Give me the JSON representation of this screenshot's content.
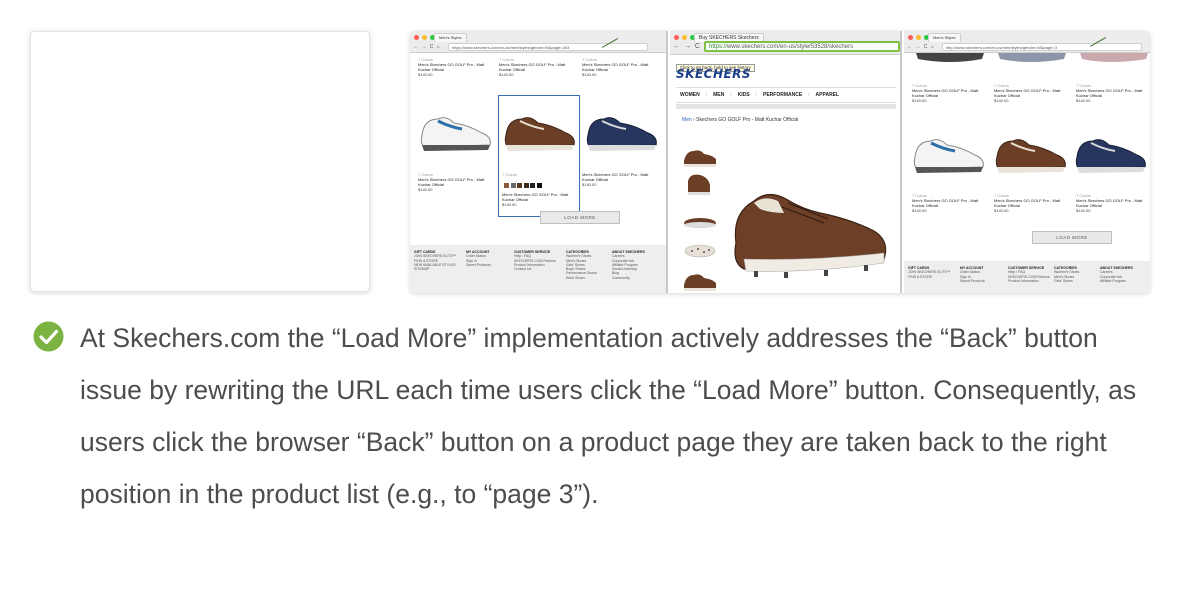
{
  "screenshot_left": {
    "tab_title": "Men's Styles",
    "url": "https://www.skechers.com/en-us/men/styles/gender=M&page=2#3",
    "products": [
      {
        "colors": "7 Colors",
        "name": "Men's Skechers GO GOLF Pro - Matt Kuchar Official",
        "price": "$140.00"
      },
      {
        "colors": "7 Colors",
        "name": "Men's Skechers GO GOLF Pro - Matt Kuchar Official",
        "price": "$140.00"
      },
      {
        "colors": "7 Colors",
        "name": "Men's Skechers GO GOLF Pro - Matt Kuchar Official",
        "price": "$140.00"
      },
      {
        "colors": "7 Colors",
        "name": "Men's Skechers GO GOLF Pro - Matt Kuchar Official",
        "price": "$140.00"
      },
      {
        "colors": "7 Colors",
        "name": "Men's Skechers GO GOLF Pro - Matt Kuchar Official",
        "price": "$140.00"
      },
      {
        "colors": "",
        "name": "Men's Skechers GO GOLF Pro - Matt Kuchar Official",
        "price": "$140.00"
      }
    ],
    "load_more_label": "LOAD MORE",
    "footer": [
      {
        "heading": "GIFT CARDS",
        "lines": [
          "JOIN SKECHERS ELITE™",
          "FIND A STORE",
          "NEW AVAILABLE STYLES",
          "SITEMAP"
        ]
      },
      {
        "heading": "MY ACCOUNT",
        "lines": [
          "Order Status",
          "Sign In",
          "Saved Products"
        ]
      },
      {
        "heading": "CUSTOMER SERVICE",
        "lines": [
          "Help / FAQ",
          "SKECHERS.COM Returns",
          "Product Information",
          "Contact Us"
        ]
      },
      {
        "heading": "CATEGORIES",
        "lines": [
          "Women's Shoes",
          "Men's Shoes",
          "Girls' Shoes",
          "Boys' Shoes",
          "Performance Shoes",
          "Work Shoes"
        ]
      },
      {
        "heading": "ABOUT SKECHERS",
        "lines": [
          "Careers",
          "Corporate Info",
          "Affiliate Program",
          "Social Listening",
          "Blog",
          "Community"
        ]
      }
    ]
  },
  "screenshot_middle": {
    "tab_title": "Buy SKECHERS Skechers",
    "url_secure": "https://",
    "url_rest": "www.skechers.com/en-us/style/53528/skechers",
    "tooltip": "Click to go back, hold to see history",
    "logo": "SKECHERS",
    "nav": [
      "WOMEN",
      "MEN",
      "KIDS",
      "PERFORMANCE",
      "APPAREL"
    ],
    "breadcrumb_link": "Men",
    "breadcrumb_rest": " › Skechers GO GOLF Pro - Matt Kuchar Official"
  },
  "screenshot_right": {
    "tab_title": "Men's Styles",
    "url": "http://www.skechers.com/en-us/men/styles/gender=M&page=3",
    "products": [
      {
        "colors": "7 Colors",
        "name": "Men's Skechers GO GOLF Pro - Matt Kuchar Official",
        "price": "$140.00"
      },
      {
        "colors": "7 Colors",
        "name": "Men's Skechers GO GOLF Pro - Matt Kuchar Official",
        "price": "$140.00"
      },
      {
        "colors": "7 Colors",
        "name": "Men's Skechers GO GOLF Pro - Matt Kuchar Official",
        "price": "$140.00"
      },
      {
        "colors": "7 Colors",
        "name": "Men's Skechers GO GOLF Pro - Matt Kuchar Official",
        "price": "$140.00"
      },
      {
        "colors": "7 Colors",
        "name": "Men's Skechers GO GOLF Pro - Matt Kuchar Official",
        "price": "$140.00"
      },
      {
        "colors": "7 Colors",
        "name": "Men's Skechers GO GOLF Pro - Matt Kuchar Official",
        "price": "$140.00"
      }
    ],
    "load_more_label": "LOAD MORE",
    "footer": [
      {
        "heading": "GIFT CARDS",
        "lines": [
          "JOIN SKECHERS ELITE™",
          "FIND A STORE"
        ]
      },
      {
        "heading": "MY ACCOUNT",
        "lines": [
          "Order Status",
          "Sign In",
          "Saved Products"
        ]
      },
      {
        "heading": "CUSTOMER SERVICE",
        "lines": [
          "Help / FAQ",
          "SKECHERS.COM Returns",
          "Product Information"
        ]
      },
      {
        "heading": "CATEGORIES",
        "lines": [
          "Women's Shoes",
          "Men's Shoes",
          "Girls' Shoes"
        ]
      },
      {
        "heading": "ABOUT SKECHERS",
        "lines": [
          "Careers",
          "Corporate Info",
          "Affiliate Program"
        ]
      }
    ]
  },
  "caption": "At Skechers.com the “Load More” implementation actively addresses the “Back” button issue by rewriting the URL each time users click the “Load More” button. Consequently, as users click the browser “Back” button on a product page they are taken back to the right position in the product list (e.g., to “page 3”).",
  "colors": {
    "check_green": "#7cb342",
    "caption_text": "#4d4d4d",
    "highlight_blue": "#3a6fb5",
    "skechers_blue": "#1b3f8a",
    "url_highlight": "#7dc242"
  },
  "icons": {
    "check": "check-circle-icon",
    "nav": "back-forward-reload-home-icons"
  }
}
